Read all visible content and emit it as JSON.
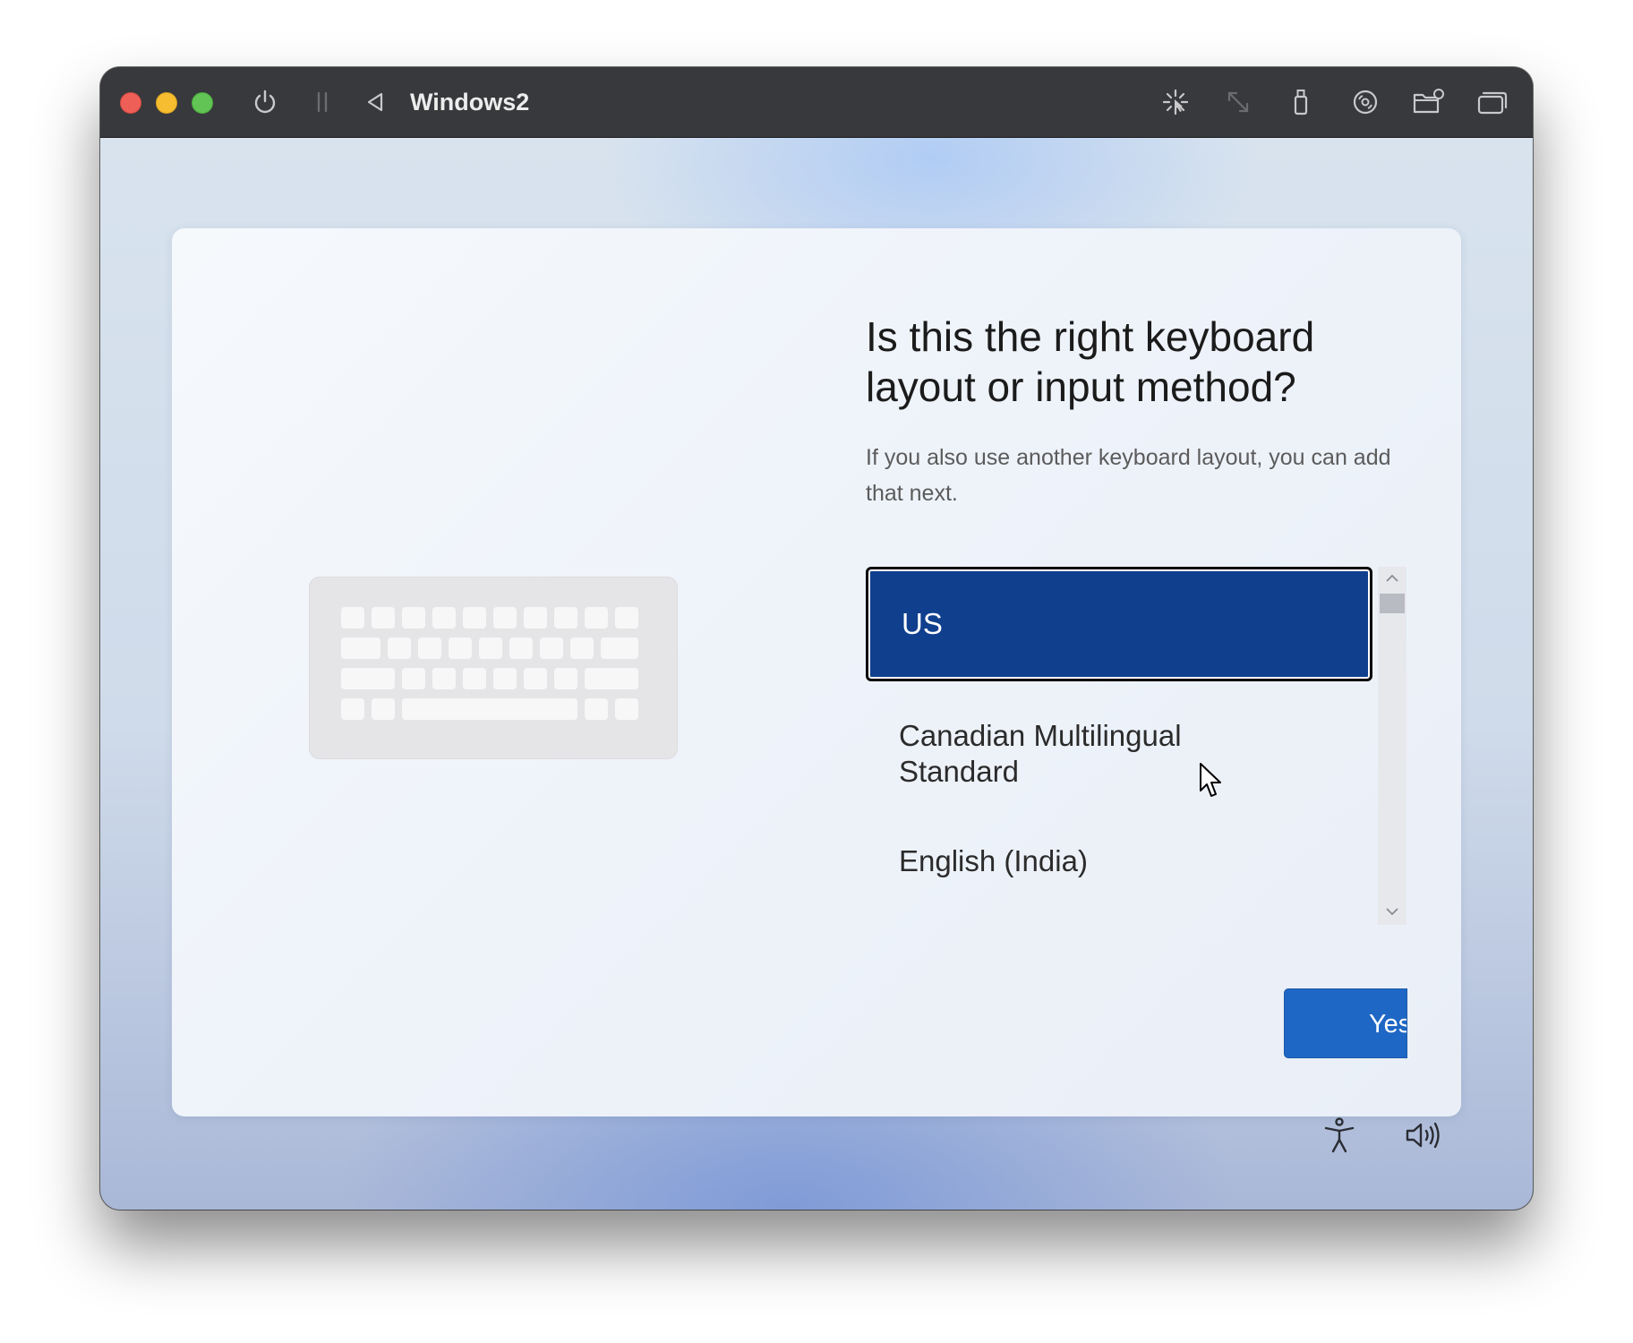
{
  "window": {
    "title": "Windows2",
    "traffic_lights": {
      "close": "#ee5f57",
      "minimize": "#f5bd2f",
      "maximize": "#61c454"
    },
    "toolbar_icons": [
      "power-icon",
      "pause-icon",
      "back-icon",
      "brightness-icon",
      "resize-icon",
      "usb-icon",
      "disc-icon",
      "shared-folder-icon",
      "display-icon"
    ]
  },
  "setup": {
    "heading": "Is this the right keyboard layout or input method?",
    "subtext": "If you also use another keyboard layout, you can add that next.",
    "illustration": "keyboard-icon",
    "layouts": [
      {
        "label": "US",
        "selected": true
      },
      {
        "label": "Canadian Multilingual Standard",
        "selected": false
      },
      {
        "label": "English (India)",
        "selected": false
      }
    ],
    "yes_button": "Yes"
  },
  "footer": {
    "icons": [
      "accessibility-icon",
      "volume-icon"
    ]
  },
  "colors": {
    "selected_item": "#103f8e",
    "primary_button": "#1f67c4"
  }
}
